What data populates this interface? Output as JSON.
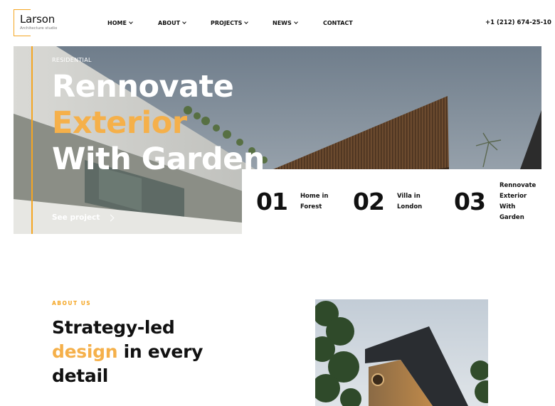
{
  "brand": {
    "name": "Larson",
    "tagline": "Architecture studio"
  },
  "nav": [
    {
      "label": "HOME",
      "has_dropdown": true
    },
    {
      "label": "ABOUT",
      "has_dropdown": true
    },
    {
      "label": "PROJECTS",
      "has_dropdown": true
    },
    {
      "label": "NEWS",
      "has_dropdown": true
    },
    {
      "label": "CONTACT",
      "has_dropdown": false
    }
  ],
  "phone": "+1 (212) 674-25-10",
  "hero": {
    "tag": "RESIDENTIAL",
    "title_line1": "Rennovate",
    "title_line2": "Exterior",
    "title_line3": "With Garden",
    "cta": "See project"
  },
  "projects": [
    {
      "number": "01",
      "label_line1": "Home in",
      "label_line2": "Forest"
    },
    {
      "number": "02",
      "label_line1": "Villa in",
      "label_line2": "London"
    },
    {
      "number": "03",
      "label_line1": "Rennovate",
      "label_line2": "Exterior With",
      "label_line3": "Garden"
    }
  ],
  "about": {
    "kicker": "ABOUT US",
    "title_line1": "Strategy-led",
    "title_accent": "design",
    "title_rest": " in every",
    "title_line3": "detail"
  },
  "colors": {
    "accent": "#f5a623",
    "accent_text": "#f5b04a",
    "text": "#111111",
    "background": "#ffffff"
  },
  "icons": {
    "nav_dropdown": "chevron-down-icon",
    "cta_arrow": "chevron-right-icon"
  }
}
